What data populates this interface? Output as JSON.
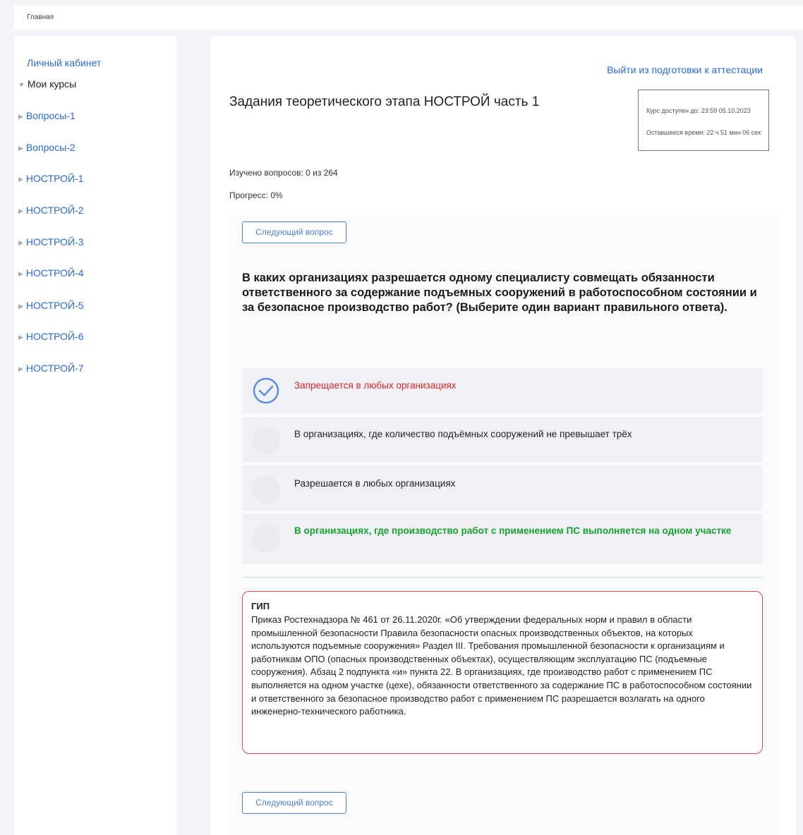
{
  "breadcrumb": "Главная",
  "sidebar": {
    "account_link": "Личный кабинет",
    "section_title": "Мои курсы",
    "courses": [
      "Вопросы-1",
      "Вопросы-2",
      "НОСТРОЙ-1",
      "НОСТРОЙ-2",
      "НОСТРОЙ-3",
      "НОСТРОЙ-4",
      "НОСТРОЙ-5",
      "НОСТРОЙ-6",
      "НОСТРОЙ-7"
    ]
  },
  "main": {
    "exit_link": "Выйти из подготовки к аттестации",
    "title": "Задания теоретического этапа НОСТРОЙ часть 1",
    "timer": {
      "available_until": "Курс доступен до: 23:59 05.10.2023",
      "remaining": "Оставшееся время: 22 ч 51 мин 06 сек"
    },
    "studied": "Изучено вопросов: 0 из 264",
    "progress": "Прогресс: 0%",
    "next_button": "Следующий вопрос",
    "question": "В каких организациях разрешается одному специалисту совмещать обязанности ответственного за содержание подъемных сооружений в работоспособном состоянии и за безопасное производство работ? (Выберите один вариант правильного ответа).",
    "options": [
      {
        "text": "Запрещается в любых организациях",
        "state": "selected-wrong"
      },
      {
        "text": "В организациях, где количество подъёмных сооружений не превышает трёх",
        "state": "normal"
      },
      {
        "text": "Разрешается в любых организациях",
        "state": "normal"
      },
      {
        "text": "В организациях, где производство работ с применением ПС выполняется на одном участке",
        "state": "correct"
      }
    ],
    "explanation": {
      "title": "ГИП",
      "body": "Приказ Ростехнадзора № 461 от 26.11.2020г. «Об утверждении федеральных норм и правил в области промышленной безопасности Правила безопасности опасных производственных объектов, на которых используются подъемные сооружения» Раздел III. Требования промышленной безопасности к организациям и работникам ОПО (опасных производственных объектах), осуществляющим эксплуатацию ПС (подъемные сооружения). Абзац 2 подпункта «и» пункта 22. В организациях, где производство работ с применением ПС выполняется на одном участке (цехе), обязанности ответственного за содержание ПС в работоспособном состоянии и ответственного за безопасное производство работ с применением ПС разрешается возлагать на одного инженерно-технического работника."
    }
  },
  "colors": {
    "link": "#2a6ad8",
    "wrong": "#e02424",
    "correct": "#17a32d",
    "check": "#5b8fd9"
  },
  "icons": [
    "triangle-down-icon",
    "triangle-right-icon",
    "check-circle-icon"
  ]
}
